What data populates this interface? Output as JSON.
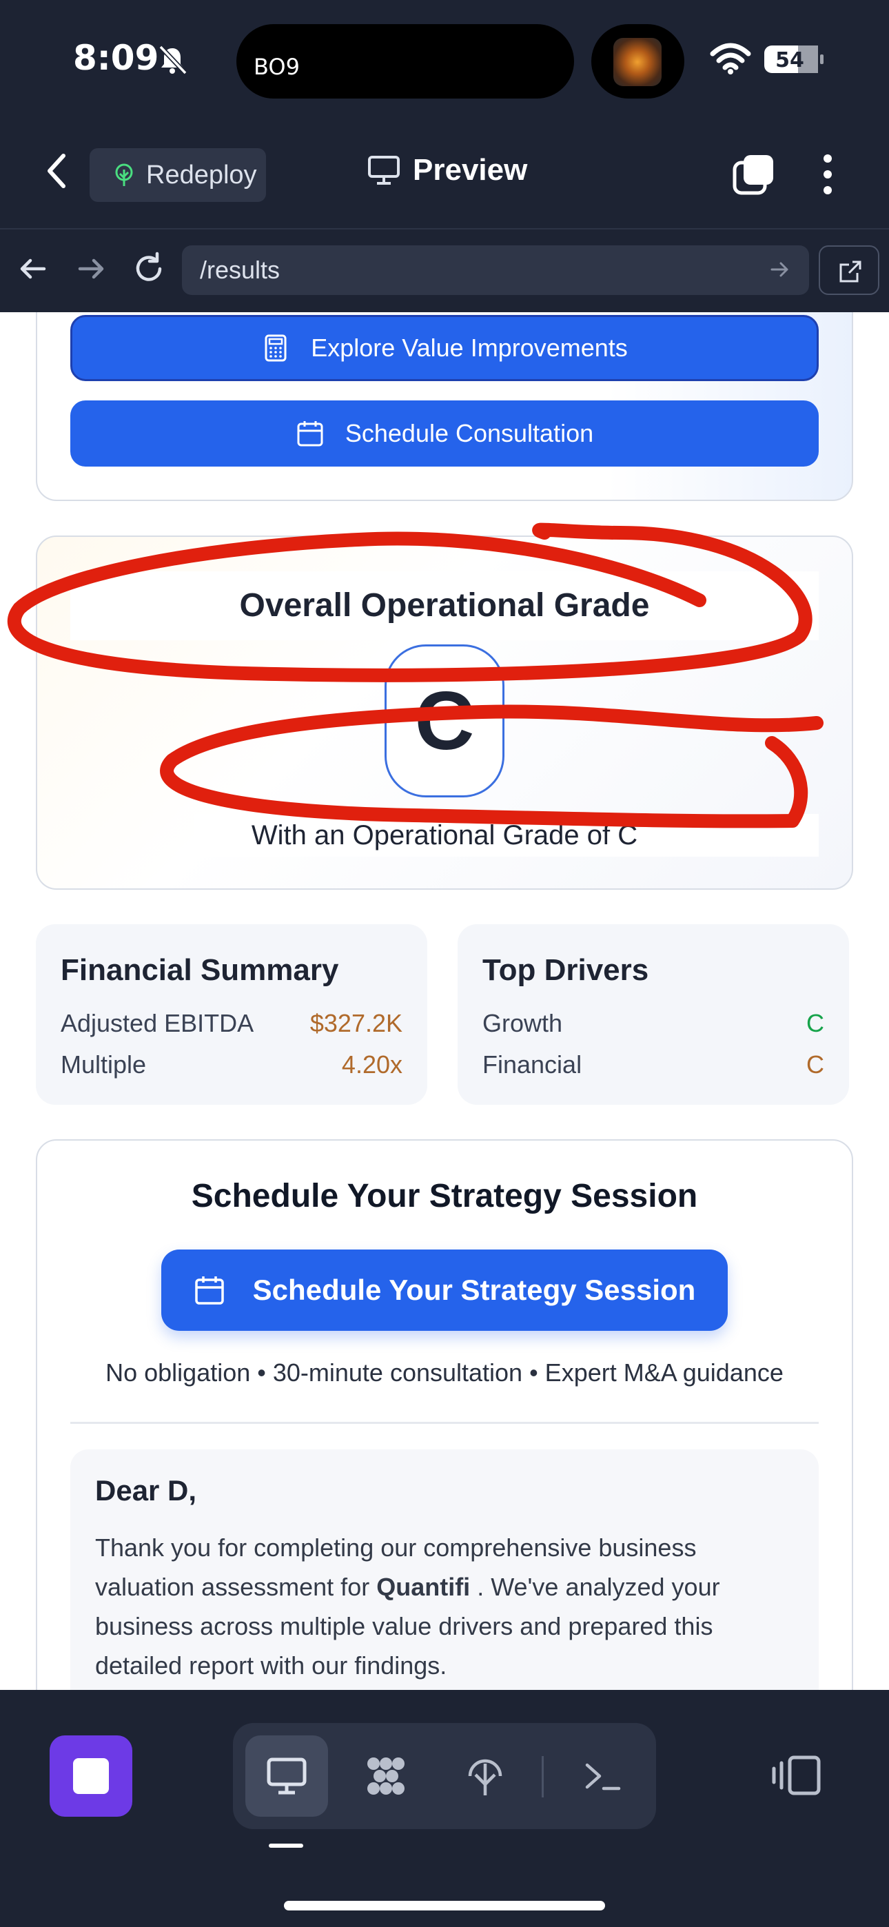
{
  "status_bar": {
    "time": "8:09",
    "island_label": "BO9",
    "battery": "54"
  },
  "app_nav": {
    "redeploy_label": "Redeploy",
    "title": "Preview"
  },
  "browser": {
    "url": "/results"
  },
  "actions": {
    "explore_label": "Explore Value Improvements",
    "schedule_label": "Schedule Consultation"
  },
  "grade_card": {
    "title": "Overall Operational Grade",
    "grade": "C",
    "subtitle": "With an Operational Grade of C"
  },
  "financial_summary": {
    "title": "Financial Summary",
    "rows": [
      {
        "label": "Adjusted EBITDA",
        "value": "$327.2K"
      },
      {
        "label": "Multiple",
        "value": "4.20x"
      }
    ]
  },
  "top_drivers": {
    "title": "Top Drivers",
    "rows": [
      {
        "label": "Growth",
        "value": "C",
        "color": "#16a34a"
      },
      {
        "label": "Financial",
        "value": "C",
        "color": "#b06a2b"
      }
    ]
  },
  "strategy": {
    "title": "Schedule Your Strategy Session",
    "button_label": "Schedule Your Strategy Session",
    "note": "No obligation • 30-minute consultation • Expert M&A guidance"
  },
  "letter": {
    "greeting": "Dear D,",
    "body_pre": "Thank you for completing our comprehensive business valuation assessment for ",
    "company": "Quantifi",
    "body_post": " . We've analyzed your business across multiple value drivers and prepared this detailed report with our findings."
  },
  "annotation_color": "#e0200e",
  "accent_color": "#2563eb"
}
